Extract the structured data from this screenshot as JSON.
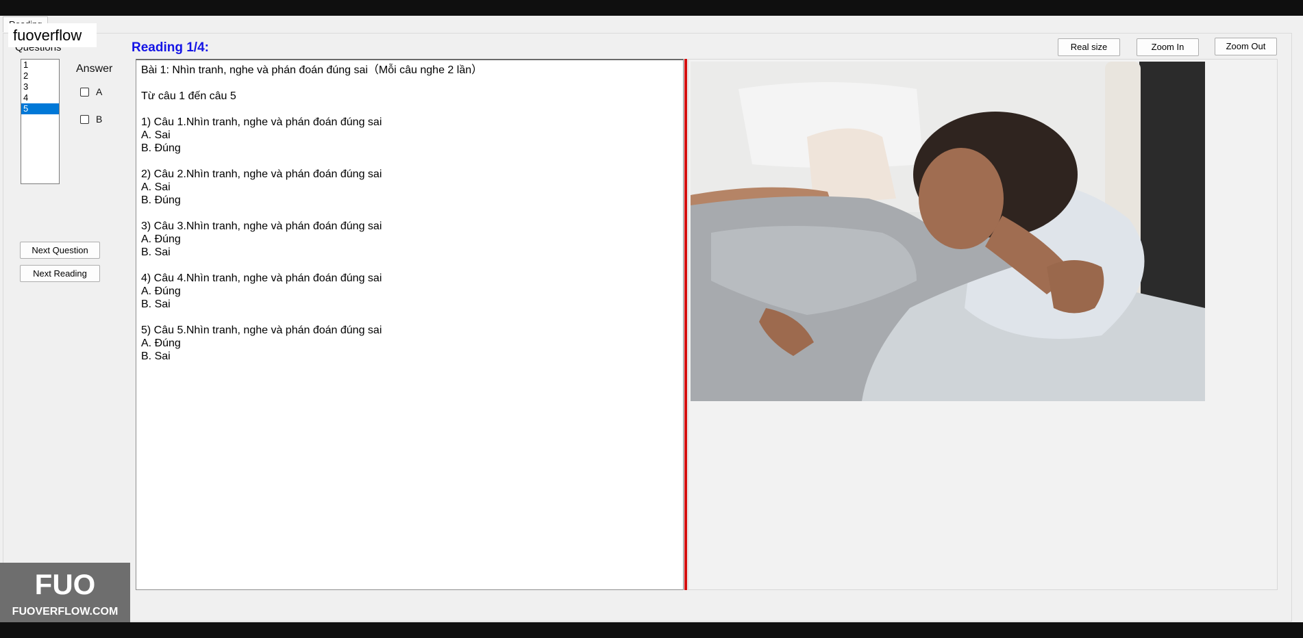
{
  "watermark": {
    "top_text": "fuoverflow",
    "logo_letters": "FUO",
    "logo_site": "FUOVERFLOW.COM"
  },
  "tab": {
    "label": "Reading"
  },
  "questions": {
    "label": "Questions",
    "items": [
      "1",
      "2",
      "3",
      "4",
      "5"
    ],
    "selected": "5"
  },
  "answer": {
    "label": "Answer",
    "options": [
      {
        "label": "A",
        "checked": false
      },
      {
        "label": "B",
        "checked": false
      }
    ]
  },
  "buttons": {
    "next_question": "Next Question",
    "next_reading": "Next Reading",
    "real_size": "Real size",
    "zoom_in": "Zoom In",
    "zoom_out": "Zoom Out"
  },
  "reading": {
    "title": "Reading 1/4:",
    "lines": [
      "Bài 1: Nhìn tranh, nghe và phán đoán đúng sai（Mỗi câu nghe 2 lần）",
      "",
      "Từ câu 1 đến câu 5",
      "",
      "1) Câu 1.Nhìn tranh, nghe và phán đoán đúng sai",
      "A.  Sai",
      "B.  Đúng",
      "",
      "2) Câu 2.Nhìn tranh, nghe và phán đoán đúng sai",
      "A.  Sai",
      "B.  Đúng",
      "",
      "3) Câu 3.Nhìn tranh, nghe và phán đoán đúng sai",
      "A.  Đúng",
      "B.  Sai",
      "",
      "4) Câu 4.Nhìn tranh, nghe và phán đoán đúng sai",
      "A.  Đúng",
      "B.  Sai",
      "",
      "5) Câu 5.Nhìn tranh, nghe và phán đoán đúng sai",
      "A.  Đúng",
      "B.  Sai"
    ]
  },
  "image": {
    "alt": "woman sleeping in bed"
  },
  "colors": {
    "reading_title": "#1414e6",
    "selected_item": "#0078d7",
    "divider": "#d41010"
  }
}
